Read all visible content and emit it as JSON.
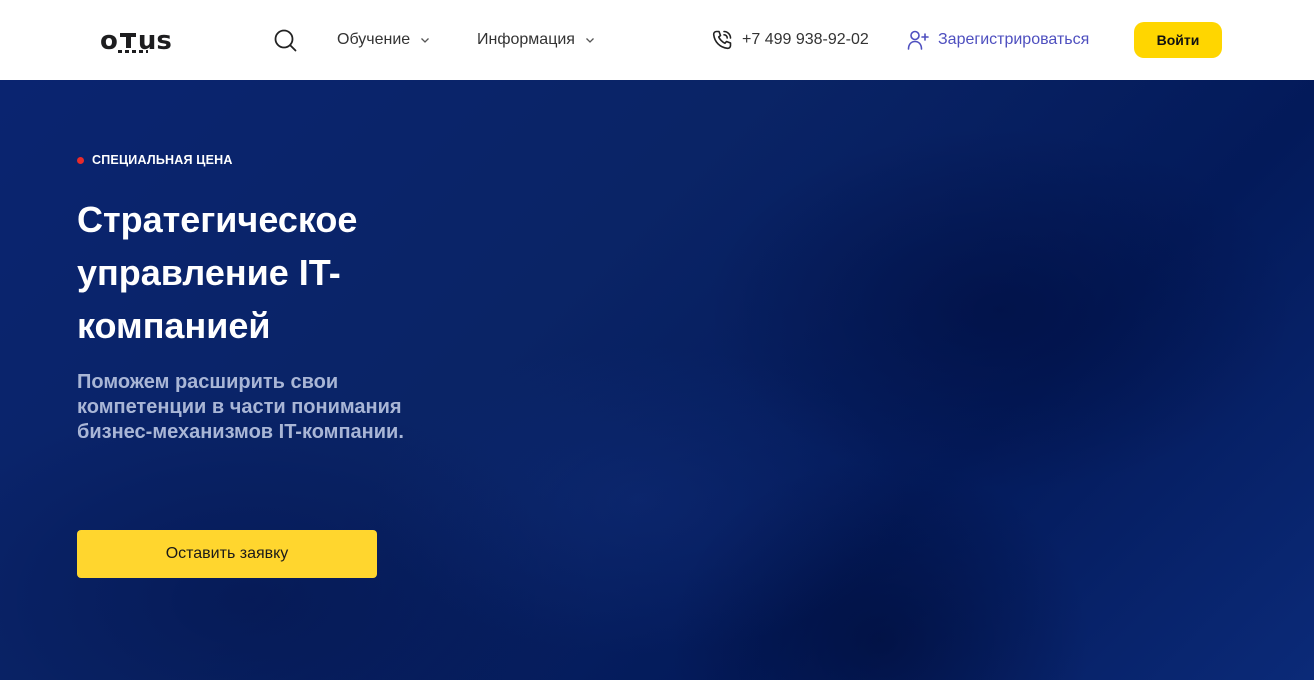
{
  "header": {
    "logo_text_left": "o",
    "logo_text_right": "us",
    "nav": [
      {
        "label": "Обучение",
        "icon": "chevron-down-icon"
      },
      {
        "label": "Информация",
        "icon": "chevron-down-icon"
      }
    ],
    "phone": "+7 499 938-92-02",
    "register_label": "Зарегистрироваться",
    "login_label": "Войти"
  },
  "hero": {
    "badge": "СПЕЦИАЛЬНАЯ ЦЕНА",
    "title": "Стратегическое управление IT-компанией",
    "subtitle": "Поможем расширить свои компетенции в части понимания бизнес-механизмов IT-компании.",
    "cta_label": "Оставить заявку"
  },
  "colors": {
    "accent_yellow": "#ffd600",
    "hero_bg": "#0a2470",
    "register_link": "#4e4fbf",
    "badge_dot": "#e82b2b"
  }
}
